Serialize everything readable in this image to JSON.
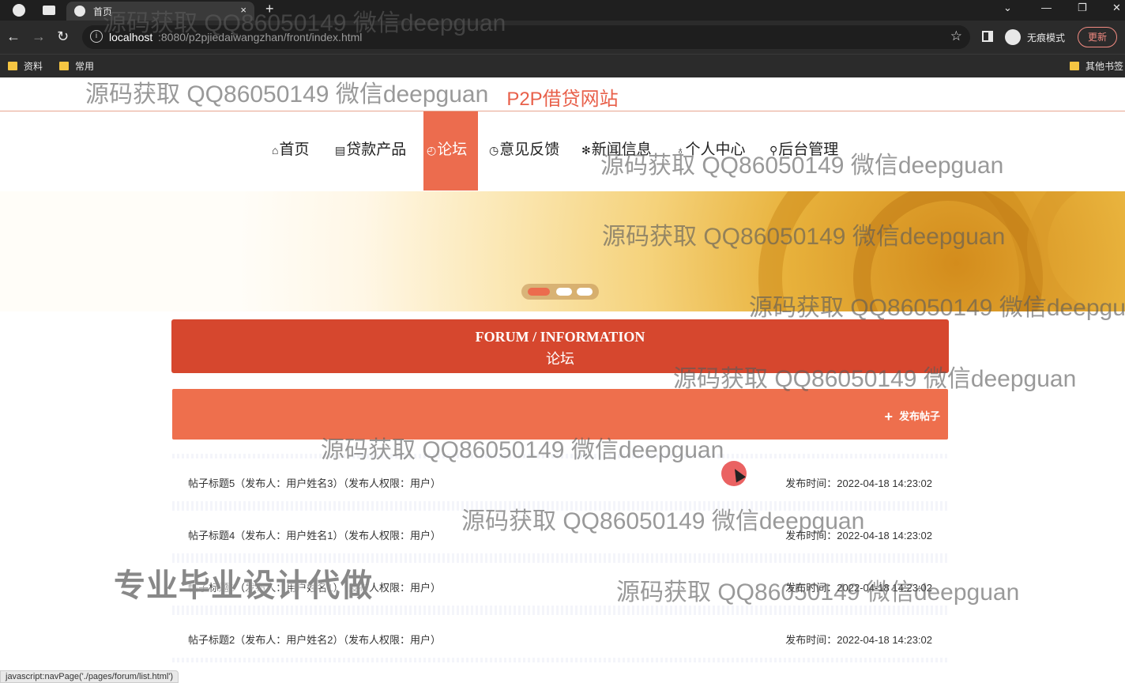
{
  "browser": {
    "tab_title": "首页",
    "tab_close": "×",
    "new_tab": "+",
    "url_host": "localhost",
    "url_path": ":8080/p2pjiedaiwangzhan/front/index.html",
    "incognito_label": "无痕模式",
    "update_label": "更新",
    "bookmarks": [
      "资料",
      "常用"
    ],
    "other_bookmarks": "其他书签",
    "status_link": "javascript:navPage('./pages/forum/list.html')"
  },
  "site": {
    "title": "P2P借贷网站",
    "nav": [
      {
        "glyph": "⌂",
        "label": "首页"
      },
      {
        "glyph": "▤",
        "label": "贷款产品"
      },
      {
        "glyph": "◴",
        "label": "论坛"
      },
      {
        "glyph": "◷",
        "label": "意见反馈"
      },
      {
        "glyph": "✻",
        "label": "新闻信息"
      },
      {
        "glyph": "♁",
        "label": "个人中心"
      },
      {
        "glyph": "⚲",
        "label": "后台管理"
      }
    ],
    "active_nav": "论坛"
  },
  "section": {
    "heading_en": "FORUM / INFORMATION",
    "heading_cn": "论坛",
    "post_button": "发布帖子"
  },
  "posts": [
    {
      "title": "帖子标题5（发布人：用户姓名3）（发布人权限：用户）",
      "time": "发布时间：2022-04-18 14:23:02"
    },
    {
      "title": "帖子标题4（发布人：用户姓名1）（发布人权限：用户）",
      "time": "发布时间：2022-04-18 14:23:02"
    },
    {
      "title": "帖子标题3（发布人：用户姓名1）（发布人权限：用户）",
      "time": "发布时间：2022-04-18 14:23:02"
    },
    {
      "title": "帖子标题2（发布人：用户姓名2）（发布人权限：用户）",
      "time": "发布时间：2022-04-18 14:23:02"
    }
  ],
  "watermark": {
    "text": "源码获取 QQ86050149 微信deepguan",
    "big_text": "专业毕业设计代做"
  },
  "colors": {
    "accent": "#ec6c4e",
    "section_head": "#d6472e",
    "postbar": "#ee6f4d"
  }
}
